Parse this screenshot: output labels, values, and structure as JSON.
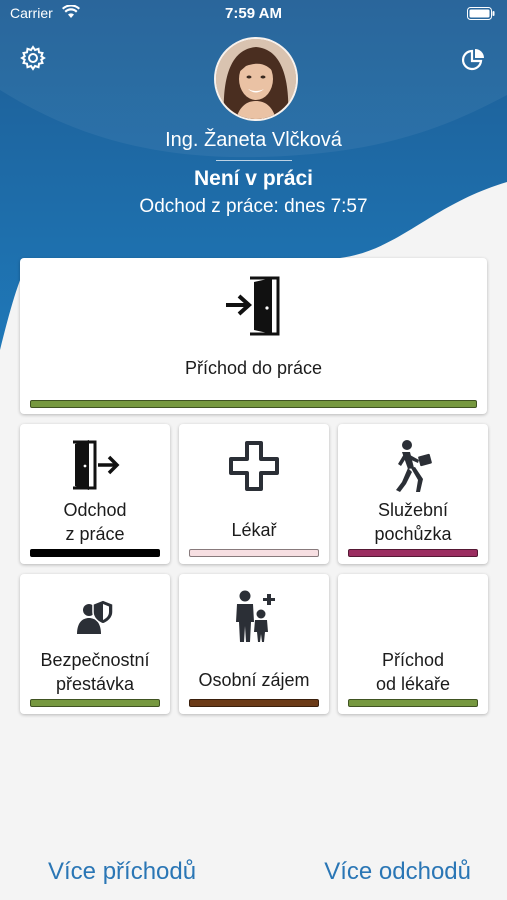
{
  "status_bar": {
    "carrier": "Carrier",
    "time": "7:59 AM"
  },
  "header": {
    "user_name": "Ing. Žaneta Vlčková",
    "state": "Není v práci",
    "last_action": "Odchod z práce: dnes 7:57"
  },
  "actions": {
    "arrival": {
      "label": "Příchod do práce",
      "color": "#76983f",
      "icon": "enter-door-icon"
    },
    "departure": {
      "line1": "Odchod",
      "line2": "z práce",
      "color": "#000000",
      "icon": "exit-door-icon"
    },
    "doctor": {
      "label": "Lékař",
      "color": "#f7dfe2",
      "icon": "medical-cross-icon"
    },
    "business_trip": {
      "line1": "Služební",
      "line2": "pochůzka",
      "color": "#9b2d60",
      "icon": "walking-person-icon"
    },
    "safety_break": {
      "line1": "Bezpečnostní",
      "line2": "přestávka",
      "color": "#76983f",
      "icon": "person-shield-icon"
    },
    "personal": {
      "label": "Osobní zájem",
      "color": "#6b3a17",
      "icon": "family-plus-icon"
    },
    "doctor_return": {
      "line1": "Příchod",
      "line2": "od lékaře",
      "color": "#76983f",
      "icon": "return-icon"
    }
  },
  "footer": {
    "more_arrivals": "Více příchodů",
    "more_departures": "Více odchodů"
  },
  "colors": {
    "header_blue": "#1e6fae",
    "link_blue": "#2a76b5",
    "background": "#f4f4f4"
  }
}
